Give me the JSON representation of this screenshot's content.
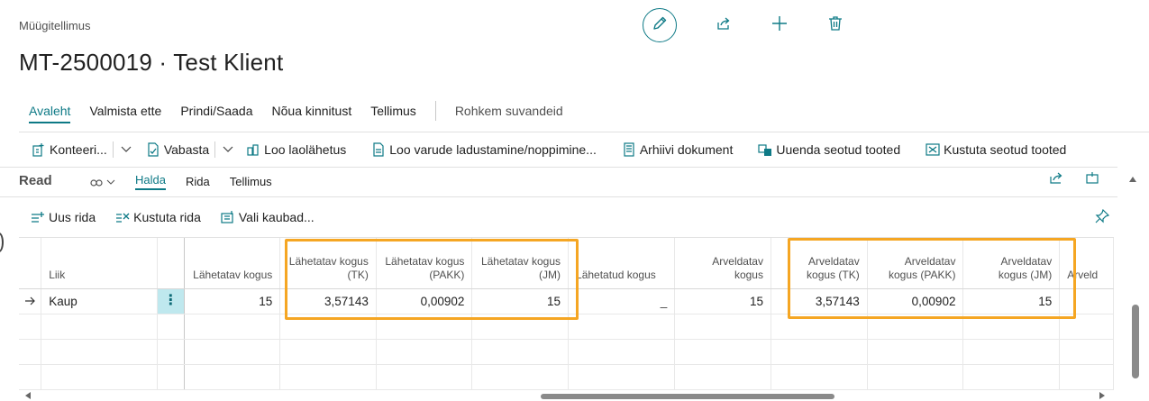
{
  "header": {
    "caption": "Müügitellimus",
    "title": "MT-2500019 · Test Klient"
  },
  "action_tabs": [
    {
      "label": "Avaleht",
      "active": true
    },
    {
      "label": "Valmista ette"
    },
    {
      "label": "Prindi/Saada"
    },
    {
      "label": "Nõua kinnitust"
    },
    {
      "label": "Tellimus"
    }
  ],
  "action_more": "Rohkem suvandeid",
  "toolbar": {
    "konteineri": "Konteeri...",
    "vabasta": "Vabasta",
    "loo_laolahetus": "Loo laolähetus",
    "loo_varude": "Loo varude ladustamine/noppimine...",
    "arhiivi": "Arhiivi dokument",
    "uuenda": "Uuenda seotud tooted",
    "kustuta": "Kustuta seotud tooted"
  },
  "lines_part": {
    "title": "Read",
    "tabs": [
      "Halda",
      "Rida",
      "Tellimus"
    ]
  },
  "lines_toolbar": {
    "uus_rida": "Uus rida",
    "kustuta_rida": "Kustuta rida",
    "vali_kaubad": "Vali kaubad..."
  },
  "grid": {
    "headers": {
      "liik": "Liik",
      "lahetatav_kogus": "Lähetatav kogus",
      "lahetatav_tk": "Lähetatav kogus (TK)",
      "lahetatav_pakk": "Lähetatav kogus (PAKK)",
      "lahetatav_jm": "Lähetatav kogus (JM)",
      "lahetatud_kogus": "Lähetatud kogus",
      "arveldatav_kogus": "Arveldatav kogus",
      "arveldatav_tk": "Arveldatav kogus (TK)",
      "arveldatav_pakk": "Arveldatav kogus (PAKK)",
      "arveldatav_jm": "Arveldatav kogus (JM)",
      "arveld_cut": "Arveld"
    },
    "row": {
      "liik": "Kaup",
      "lahetatav_kogus": "15",
      "lahetatav_tk": "3,57143",
      "lahetatav_pakk": "0,00902",
      "lahetatav_jm": "15",
      "lahetatud_kogus": "_",
      "arveldatav_kogus": "15",
      "arveldatav_tk": "3,57143",
      "arveldatav_pakk": "0,00902",
      "arveldatav_jm": "15"
    }
  },
  "colors": {
    "accent": "#0e7a86",
    "highlight": "#f5a623",
    "menu_cell": "#bfe8ee"
  }
}
